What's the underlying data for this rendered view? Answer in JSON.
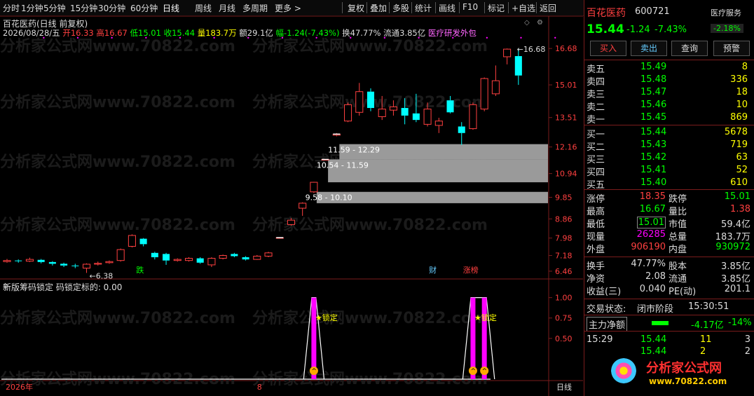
{
  "toolbar": {
    "items": [
      "分时",
      "1分钟",
      "5分钟",
      "15分钟",
      "30分钟",
      "60分钟",
      "日线",
      "周线",
      "月线",
      "多周期",
      "更多 >"
    ],
    "selected": "日线",
    "right_items": [
      "复权",
      "叠加",
      "多股",
      "统计",
      "画线",
      "F10",
      "标记",
      "+自选",
      "返回"
    ]
  },
  "chart": {
    "title": "百花医药(日线 前复权)",
    "info_line": {
      "date": "2026/08/28/五",
      "open": "开16.33",
      "high": "高16.67",
      "low": "低15.01",
      "close": "收15.44",
      "volume": "量183.7万",
      "amount": "额29.1亿",
      "change": "幅-1.24(-7.43%)",
      "turnover": "换47.77%",
      "float": "流通3.85亿",
      "concept": "医疗研发外包"
    },
    "price_axis": [
      "16.68",
      "15.01",
      "13.51",
      "12.16",
      "10.94",
      "9.85",
      "8.86",
      "7.98",
      "7.18",
      "6.46"
    ],
    "annotations": {
      "high_label": "16.68",
      "low_label": "6.38",
      "gap1": "11.59 - 12.29",
      "gap2": "10.54 - 11.59",
      "gap3": "9.58 - 10.10",
      "tag_die": "跌",
      "tag_cai": "财",
      "tag_zhang": "涨榜"
    },
    "indicator": {
      "title": "新版筹码锁定 码锁定标的: 0.00",
      "axis": [
        "1.00",
        "0.75",
        "0.50"
      ],
      "lock_label": "锁定",
      "lock_label2": "锁定"
    },
    "bottom": {
      "year": "2026年",
      "month": "8",
      "period": "日线"
    }
  },
  "chart_data": {
    "type": "candlestick",
    "ylim": [
      6.2,
      17.2
    ],
    "candles": [
      {
        "o": 6.9,
        "c": 6.95,
        "h": 7.02,
        "l": 6.85
      },
      {
        "o": 6.95,
        "c": 6.92,
        "h": 7.0,
        "l": 6.85
      },
      {
        "o": 6.92,
        "c": 7.0,
        "h": 7.08,
        "l": 6.88
      },
      {
        "o": 6.98,
        "c": 6.88,
        "h": 7.02,
        "l": 6.82
      },
      {
        "o": 6.88,
        "c": 6.8,
        "h": 6.92,
        "l": 6.72
      },
      {
        "o": 6.8,
        "c": 6.72,
        "h": 6.85,
        "l": 6.65
      },
      {
        "o": 6.72,
        "c": 6.7,
        "h": 6.8,
        "l": 6.6
      },
      {
        "o": 6.6,
        "c": 6.78,
        "h": 6.82,
        "l": 6.38
      },
      {
        "o": 6.78,
        "c": 6.82,
        "h": 6.9,
        "l": 6.72
      },
      {
        "o": 6.85,
        "c": 6.9,
        "h": 6.95,
        "l": 6.8
      },
      {
        "o": 6.95,
        "c": 7.45,
        "h": 7.5,
        "l": 6.9
      },
      {
        "o": 7.6,
        "c": 8.1,
        "h": 8.15,
        "l": 7.55
      },
      {
        "o": 7.95,
        "c": 7.7,
        "h": 7.98,
        "l": 7.6
      },
      {
        "o": 7.3,
        "c": 7.1,
        "h": 7.35,
        "l": 7.0
      },
      {
        "o": 7.25,
        "c": 6.95,
        "h": 7.3,
        "l": 6.75
      },
      {
        "o": 6.95,
        "c": 7.0,
        "h": 7.05,
        "l": 6.9
      },
      {
        "o": 6.95,
        "c": 7.05,
        "h": 7.1,
        "l": 6.9
      },
      {
        "o": 7.05,
        "c": 6.85,
        "h": 7.1,
        "l": 6.8
      },
      {
        "o": 6.75,
        "c": 7.05,
        "h": 7.1,
        "l": 6.65
      },
      {
        "o": 7.05,
        "c": 7.18,
        "h": 7.22,
        "l": 7.0
      },
      {
        "o": 7.25,
        "c": 7.15,
        "h": 7.3,
        "l": 7.1
      },
      {
        "o": 7.1,
        "c": 7.0,
        "h": 7.15,
        "l": 6.95
      },
      {
        "o": 7.0,
        "c": 7.15,
        "h": 7.2,
        "l": 6.98
      },
      {
        "o": 7.15,
        "c": 7.3,
        "h": 7.35,
        "l": 7.1
      },
      {
        "o": 8.0,
        "c": 8.0,
        "h": 8.0,
        "l": 8.0
      },
      {
        "o": 8.6,
        "c": 8.8,
        "h": 8.9,
        "l": 8.55
      },
      {
        "o": 9.35,
        "c": 9.58,
        "h": 9.62,
        "l": 9.0
      },
      {
        "o": 10.1,
        "c": 10.54,
        "h": 10.56,
        "l": 10.05
      },
      {
        "o": 11.59,
        "c": 11.59,
        "h": 11.59,
        "l": 11.59
      },
      {
        "o": 12.7,
        "c": 12.75,
        "h": 12.8,
        "l": 12.65
      },
      {
        "o": 13.35,
        "c": 14.1,
        "h": 14.2,
        "l": 13.3
      },
      {
        "o": 13.75,
        "c": 14.7,
        "h": 15.1,
        "l": 13.6
      },
      {
        "o": 14.7,
        "c": 13.95,
        "h": 14.85,
        "l": 13.8
      },
      {
        "o": 13.55,
        "c": 13.9,
        "h": 14.5,
        "l": 13.4
      },
      {
        "o": 13.85,
        "c": 14.0,
        "h": 14.3,
        "l": 13.6
      },
      {
        "o": 13.95,
        "c": 13.6,
        "h": 14.4,
        "l": 13.2
      },
      {
        "o": 13.7,
        "c": 13.4,
        "h": 14.6,
        "l": 13.3
      },
      {
        "o": 13.2,
        "c": 13.9,
        "h": 14.2,
        "l": 13.1
      },
      {
        "o": 13.15,
        "c": 13.35,
        "h": 13.5,
        "l": 12.8
      },
      {
        "o": 14.3,
        "c": 13.75,
        "h": 14.5,
        "l": 13.7
      },
      {
        "o": 13.1,
        "c": 12.8,
        "h": 13.3,
        "l": 12.25
      },
      {
        "o": 13.0,
        "c": 14.1,
        "h": 14.2,
        "l": 12.95
      },
      {
        "o": 13.9,
        "c": 15.3,
        "h": 15.35,
        "l": 13.8
      },
      {
        "o": 14.6,
        "c": 15.2,
        "h": 15.9,
        "l": 14.5
      },
      {
        "o": 16.3,
        "c": 16.65,
        "h": 16.68,
        "l": 15.95
      },
      {
        "o": 16.33,
        "c": 15.44,
        "h": 16.67,
        "l": 15.01
      }
    ],
    "gaps": [
      {
        "low": 11.59,
        "high": 12.29
      },
      {
        "low": 10.54,
        "high": 11.59
      },
      {
        "low": 9.58,
        "high": 10.1
      }
    ],
    "indicator_ylim": [
      0,
      1.1
    ],
    "indicator_peaks": [
      {
        "index": 27,
        "value": 1.0
      },
      {
        "index": 41,
        "value": 1.0
      },
      {
        "index": 42,
        "value": 1.0
      }
    ]
  },
  "quote": {
    "name": "百花医药",
    "code": "600721",
    "service": "医疗服务",
    "service_pct": "-2.18%",
    "price": "15.44",
    "change": "-1.24",
    "pct": "-7.43%",
    "buttons": [
      "买入",
      "卖出",
      "查询",
      "预警"
    ],
    "sells": [
      {
        "label": "卖五",
        "price": "15.49",
        "vol": "8"
      },
      {
        "label": "卖四",
        "price": "15.48",
        "vol": "336"
      },
      {
        "label": "卖三",
        "price": "15.47",
        "vol": "18"
      },
      {
        "label": "卖二",
        "price": "15.46",
        "vol": "10"
      },
      {
        "label": "卖一",
        "price": "15.45",
        "vol": "869"
      }
    ],
    "buys": [
      {
        "label": "买一",
        "price": "15.44",
        "vol": "5678"
      },
      {
        "label": "买二",
        "price": "15.43",
        "vol": "719"
      },
      {
        "label": "买三",
        "price": "15.42",
        "vol": "63"
      },
      {
        "label": "买四",
        "price": "15.41",
        "vol": "52"
      },
      {
        "label": "买五",
        "price": "15.40",
        "vol": "610"
      }
    ],
    "stats": [
      {
        "l1": "涨停",
        "v1": "18.35",
        "l2": "跌停",
        "v2": "15.01"
      },
      {
        "l1": "最高",
        "v1": "16.67",
        "l2": "量比",
        "v2": "1.38"
      },
      {
        "l1": "最低",
        "v1": "15.01",
        "l2": "市值",
        "v2": "59.4亿"
      },
      {
        "l1": "现量",
        "v1": "26285",
        "l2": "总量",
        "v2": "183.7万"
      },
      {
        "l1": "外盘",
        "v1": "906190",
        "l2": "内盘",
        "v2": "930972"
      }
    ],
    "stats2": [
      {
        "l1": "换手",
        "v1": "47.77%",
        "l2": "股本",
        "v2": "3.85亿"
      },
      {
        "l1": "净资",
        "v1": "2.08",
        "l2": "流通",
        "v2": "3.85亿"
      },
      {
        "l1": "收益(三)",
        "v1": "0.040",
        "l2": "PE(动)",
        "v2": "201.1"
      }
    ],
    "trade_status_label": "交易状态:",
    "trade_status": "闭市阶段",
    "trade_time": "15:30:51",
    "main_flow_label": "主力净额",
    "main_flow": "-4.17亿",
    "main_flow_pct": "-14%",
    "ticks": [
      {
        "time": "15:29",
        "price": "15.44",
        "vol": "11",
        "n": "3"
      },
      {
        "time": "",
        "price": "15.44",
        "vol": "2",
        "n": "2"
      }
    ],
    "logo_text": "分析家公式网",
    "logo_url": "www.70822.com"
  },
  "watermark": "分析家公式网www.70822.com",
  "colors": {
    "up": "#ff4040",
    "down": "#00ffff",
    "bg": "#000000",
    "grid": "#7a1c1c",
    "gap": "#9a9a9a",
    "magenta": "#ff00ff"
  }
}
